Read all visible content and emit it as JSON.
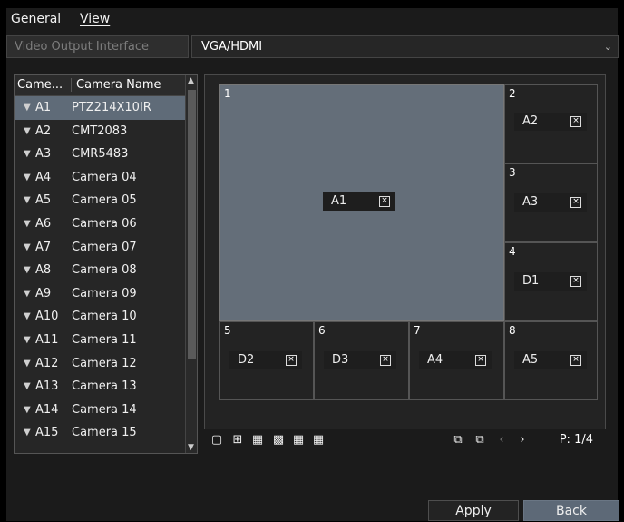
{
  "tabs": {
    "general": "General",
    "view": "View"
  },
  "output": {
    "label": "Video Output Interface",
    "value": "VGA/HDMI"
  },
  "cameralist": {
    "header": {
      "col1": "Came...",
      "col2": "Camera Name"
    },
    "rows": [
      {
        "id": "A1",
        "name": "PTZ214X10IR"
      },
      {
        "id": "A2",
        "name": "CMT2083"
      },
      {
        "id": "A3",
        "name": "CMR5483"
      },
      {
        "id": "A4",
        "name": "Camera 04"
      },
      {
        "id": "A5",
        "name": "Camera 05"
      },
      {
        "id": "A6",
        "name": "Camera 06"
      },
      {
        "id": "A7",
        "name": "Camera 07"
      },
      {
        "id": "A8",
        "name": "Camera 08"
      },
      {
        "id": "A9",
        "name": "Camera 09"
      },
      {
        "id": "A10",
        "name": "Camera 10"
      },
      {
        "id": "A11",
        "name": "Camera 11"
      },
      {
        "id": "A12",
        "name": "Camera 12"
      },
      {
        "id": "A13",
        "name": "Camera 13"
      },
      {
        "id": "A14",
        "name": "Camera 14"
      },
      {
        "id": "A15",
        "name": "Camera 15"
      }
    ]
  },
  "layout": {
    "cells": [
      {
        "num": "1",
        "cam": "A1"
      },
      {
        "num": "2",
        "cam": "A2"
      },
      {
        "num": "3",
        "cam": "A3"
      },
      {
        "num": "4",
        "cam": "D1"
      },
      {
        "num": "5",
        "cam": "D2"
      },
      {
        "num": "6",
        "cam": "D3"
      },
      {
        "num": "7",
        "cam": "A4"
      },
      {
        "num": "8",
        "cam": "A5"
      }
    ]
  },
  "toolbar": {
    "page": "P: 1/4"
  },
  "buttons": {
    "apply": "Apply",
    "back": "Back"
  }
}
